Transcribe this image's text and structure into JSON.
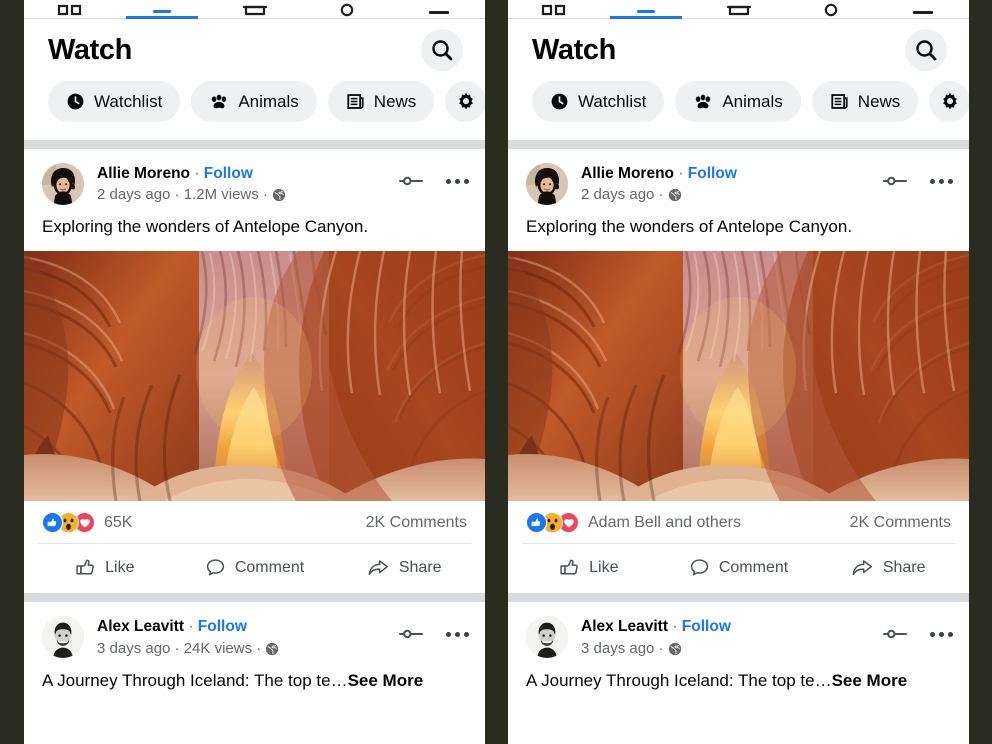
{
  "background_color": "#2b2c20",
  "accent_color": "#1877f2",
  "tabbar": {
    "tabs": [
      {
        "name": "home",
        "icon": "home-icon",
        "active": false
      },
      {
        "name": "watch",
        "icon": "watch-icon",
        "active": true
      },
      {
        "name": "marketplace",
        "icon": "marketplace-icon",
        "active": false
      },
      {
        "name": "notifications",
        "icon": "bell-icon",
        "active": false
      },
      {
        "name": "menu",
        "icon": "menu-icon",
        "active": false
      }
    ]
  },
  "header": {
    "title": "Watch",
    "search_icon": "search-icon"
  },
  "chips": [
    {
      "label": "Watchlist",
      "icon": "clock-icon"
    },
    {
      "label": "Animals",
      "icon": "paw-icon"
    },
    {
      "label": "News",
      "icon": "newspaper-icon"
    },
    {
      "label": "",
      "icon": "gear-icon"
    }
  ],
  "variants": [
    {
      "id": "left",
      "posts": [
        {
          "author": "Allie Moreno",
          "separator": "·",
          "follow_label": "Follow",
          "timestamp": "2 days ago",
          "views": "1.2M views",
          "privacy_icon": "globe-icon",
          "meta_line": "2 days ago · 1.2M views ·",
          "caption": "Exploring the wonders of Antelope Canyon.",
          "has_media": true,
          "media_alt": "Antelope Canyon slot canyon photo",
          "reactions_label": "65K",
          "comments_label": "2K Comments",
          "reaction_icons": [
            "like-icon",
            "wow-icon",
            "love-icon"
          ],
          "actions": [
            {
              "label": "Like",
              "icon": "thumbs-up-icon"
            },
            {
              "label": "Comment",
              "icon": "comment-bubble-icon"
            },
            {
              "label": "Share",
              "icon": "share-arrow-icon"
            }
          ]
        },
        {
          "author": "Alex Leavitt",
          "separator": "·",
          "follow_label": "Follow",
          "timestamp": "3 days ago",
          "views": "24K views",
          "privacy_icon": "globe-icon",
          "meta_line": "3 days ago · 24K views ·",
          "caption": "A Journey Through Iceland: The top te…",
          "see_more_label": "See More",
          "has_media": false
        }
      ]
    },
    {
      "id": "right",
      "posts": [
        {
          "author": "Allie Moreno",
          "separator": "·",
          "follow_label": "Follow",
          "timestamp": "2 days ago",
          "views": "",
          "privacy_icon": "globe-icon",
          "meta_line": "2 days ago ·",
          "caption": "Exploring the wonders of Antelope Canyon.",
          "has_media": true,
          "media_alt": "Antelope Canyon slot canyon photo",
          "reactions_label": "Adam Bell and others",
          "comments_label": "2K Comments",
          "reaction_icons": [
            "like-icon",
            "wow-icon",
            "love-icon"
          ],
          "actions": [
            {
              "label": "Like",
              "icon": "thumbs-up-icon"
            },
            {
              "label": "Comment",
              "icon": "comment-bubble-icon"
            },
            {
              "label": "Share",
              "icon": "share-arrow-icon"
            }
          ]
        },
        {
          "author": "Alex Leavitt",
          "separator": "·",
          "follow_label": "Follow",
          "timestamp": "3 days ago",
          "views": "",
          "privacy_icon": "globe-icon",
          "meta_line": "3 days ago ·",
          "caption": "A Journey Through Iceland: The top te…",
          "see_more_label": "See More",
          "has_media": false
        }
      ]
    }
  ]
}
